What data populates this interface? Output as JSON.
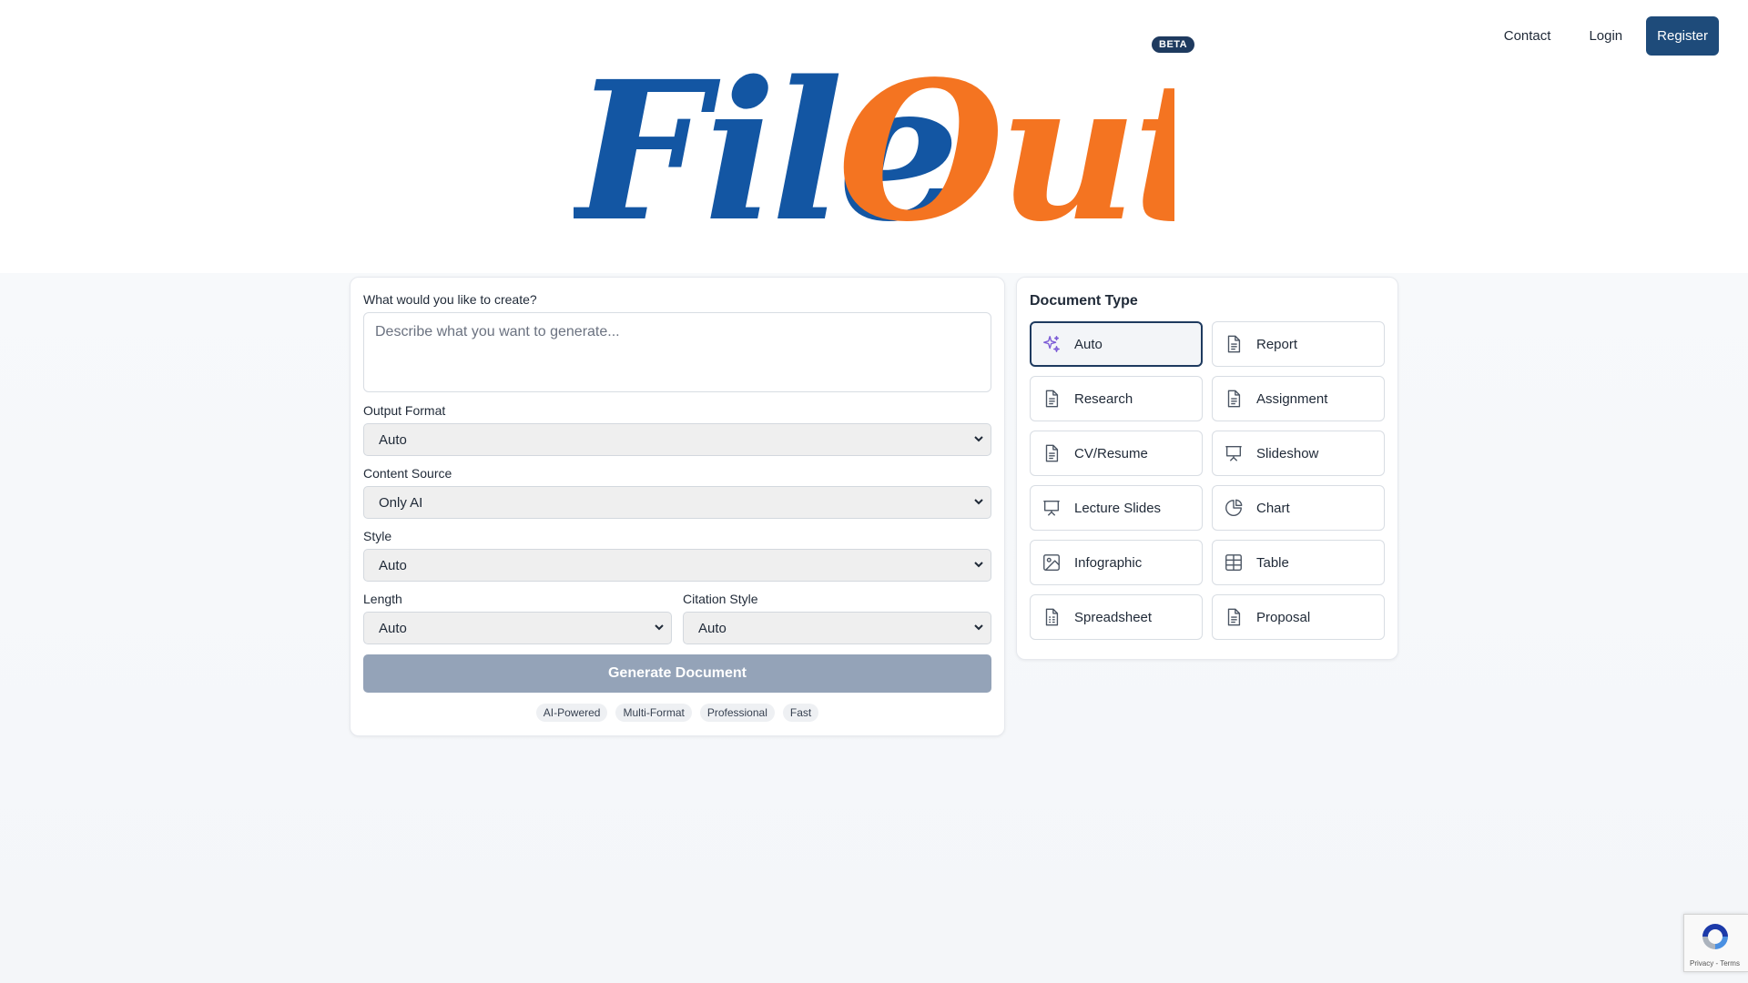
{
  "nav": {
    "contact": "Contact",
    "login": "Login",
    "register": "Register"
  },
  "logo": {
    "part1": "File",
    "part2": "Out",
    "badge": "BETA",
    "color1": "#1356a3",
    "color2": "#f47421"
  },
  "form": {
    "prompt_label": "What would you like to create?",
    "prompt_placeholder": "Describe what you want to generate...",
    "output_format_label": "Output Format",
    "output_format_value": "Auto",
    "content_source_label": "Content Source",
    "content_source_value": "Only AI",
    "style_label": "Style",
    "style_value": "Auto",
    "length_label": "Length",
    "length_value": "Auto",
    "citation_label": "Citation Style",
    "citation_value": "Auto",
    "generate_label": "Generate Document",
    "chips": [
      "AI-Powered",
      "Multi-Format",
      "Professional",
      "Fast"
    ]
  },
  "document_type": {
    "title": "Document Type",
    "items": [
      {
        "label": "Auto",
        "icon": "sparkles-icon"
      },
      {
        "label": "Report",
        "icon": "document-icon"
      },
      {
        "label": "Research",
        "icon": "document-icon"
      },
      {
        "label": "Assignment",
        "icon": "document-icon"
      },
      {
        "label": "CV/Resume",
        "icon": "document-icon"
      },
      {
        "label": "Slideshow",
        "icon": "presentation-icon"
      },
      {
        "label": "Lecture Slides",
        "icon": "presentation-icon"
      },
      {
        "label": "Chart",
        "icon": "pie-chart-icon"
      },
      {
        "label": "Infographic",
        "icon": "image-icon"
      },
      {
        "label": "Table",
        "icon": "table-icon"
      },
      {
        "label": "Spreadsheet",
        "icon": "spreadsheet-icon"
      },
      {
        "label": "Proposal",
        "icon": "document-icon"
      }
    ],
    "selected": "Auto"
  },
  "recaptcha": {
    "text": "Privacy - Terms"
  }
}
